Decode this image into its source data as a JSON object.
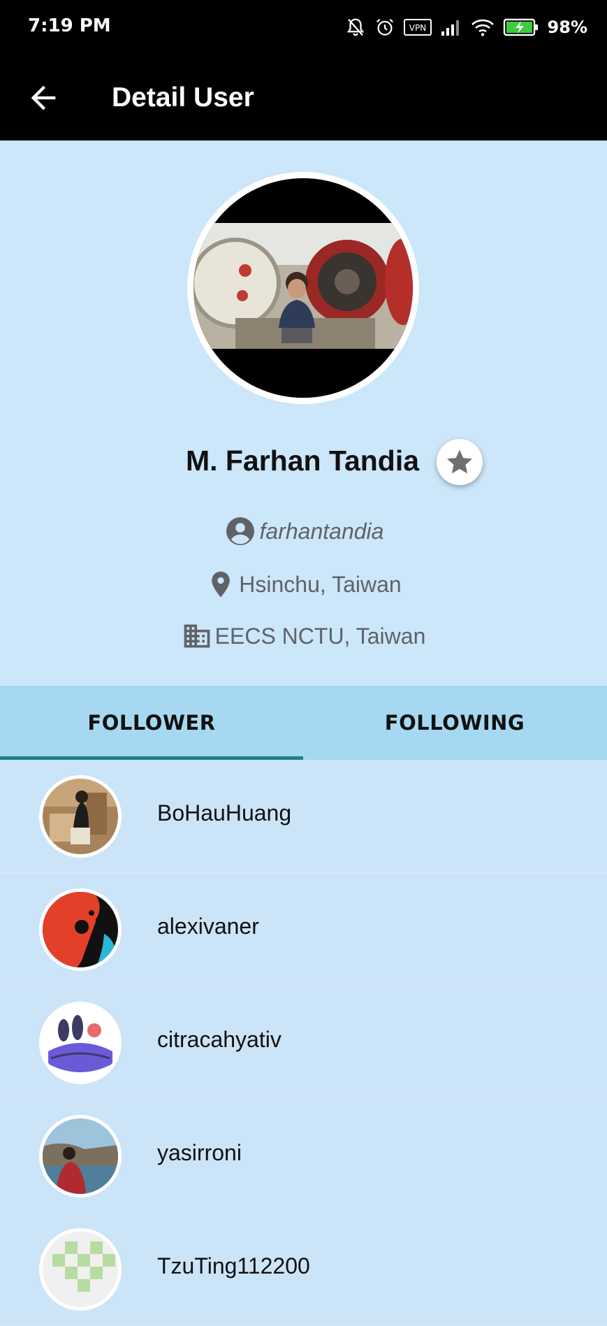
{
  "status_bar": {
    "time": "7:19 PM",
    "vpn_label": "VPN",
    "battery_percent": "98%",
    "icons": [
      "bell-off-icon",
      "alarm-icon",
      "vpn-icon",
      "signal-icon",
      "wifi-icon",
      "battery-charging-icon"
    ]
  },
  "app_bar": {
    "title": "Detail User",
    "back_icon": "arrow-left-icon"
  },
  "profile": {
    "name": "M. Farhan Tandia",
    "username": "farhantandia",
    "location": "Hsinchu, Taiwan",
    "company": "EECS NCTU, Taiwan",
    "favorite_icon": "star-icon"
  },
  "tabs": [
    {
      "label": "FOLLOWER",
      "selected": true
    },
    {
      "label": "FOLLOWING",
      "selected": false
    }
  ],
  "followers": [
    {
      "login": "BoHauHuang"
    },
    {
      "login": "alexivaner"
    },
    {
      "login": "citracahyativ"
    },
    {
      "login": "yasirroni"
    },
    {
      "login": "TzuTing112200"
    }
  ],
  "colors": {
    "background": "#cce6fa",
    "app_bar": "#000000",
    "tab_bar": "#a7d8f1",
    "tab_indicator": "#1e8282",
    "secondary_text": "#5f6368"
  }
}
